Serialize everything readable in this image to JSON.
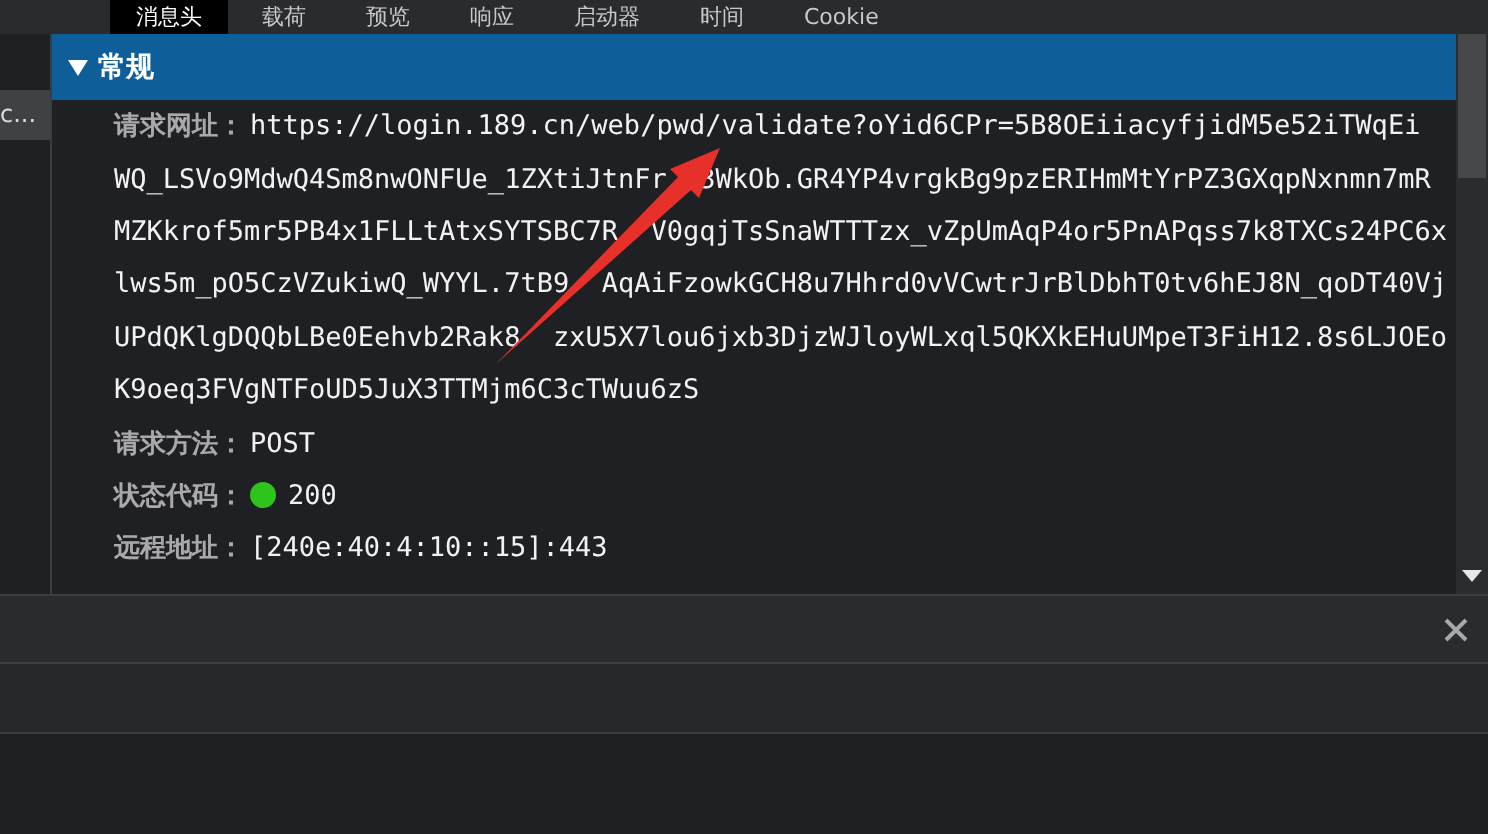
{
  "tabs": [
    {
      "label": "消息头",
      "selected": true
    },
    {
      "label": "载荷",
      "selected": false
    },
    {
      "label": "预览",
      "selected": false
    },
    {
      "label": "响应",
      "selected": false
    },
    {
      "label": "启动器",
      "selected": false
    },
    {
      "label": "时间",
      "selected": false
    },
    {
      "label": "Cookie",
      "selected": false
    }
  ],
  "sidebar": {
    "items": [
      {
        "label": "c...",
        "selected": true
      }
    ]
  },
  "section": {
    "title": "常规",
    "expanded": true,
    "fields": [
      {
        "kind": "url",
        "label": "请求网址：",
        "lines": [
          [
            "https://login.189.cn/web/pwd/validate?oYid6CPr=5B8OEiiacyfjidM5e52iTWqEi"
          ],
          [
            "WQ_LSVo9MdwQ4Sm8nwONFUe_1ZXtiJtnFr",
            "3WkOb.GR4YP4vrgkBg9pzERIHmMtYrPZ3GXqpNxnmn7mR"
          ],
          [
            "MZKkrof5mr5PB4x1FLLtAtxSYTSBC7R",
            "V0gqjTsSnaWTTTzx_vZpUmAqP4or5PnAPqss7k8TXCs24PC6x"
          ],
          [
            "lws5m_pO5CzVZukiwQ_WYYL.7tB9",
            "AqAiFzowkGCH8u7Hhrd0vVCwtrJrBlDbhT0tv6hEJ8N_qoDT40Vj"
          ],
          [
            "UPdQKlgDQQbLBe0Eehvb2Rak8",
            "zxU5X7lou6jxb3DjzWJloyWLxql5QKXkEHuUMpeT3FiH12.8s6LJOEo"
          ],
          [
            "K9oeq3FVgNTFoUD5JuX3TTMjm6C3cTWuu6zS"
          ]
        ]
      },
      {
        "kind": "text",
        "label": "请求方法：",
        "value": "POST"
      },
      {
        "kind": "status",
        "label": "状态代码：",
        "value": "200",
        "color": "#2ec41c"
      },
      {
        "kind": "text",
        "label": "远程地址：",
        "value": "[240e:40:4:10::15]:443"
      }
    ]
  }
}
